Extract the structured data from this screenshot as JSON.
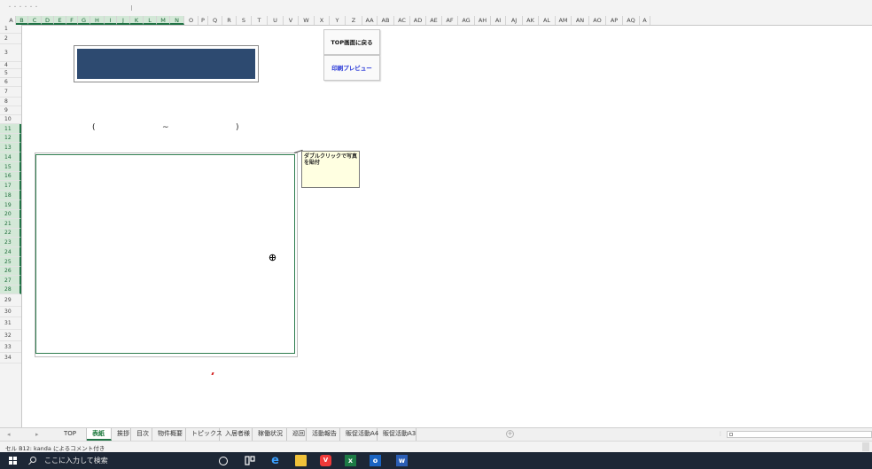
{
  "columns": [
    "A",
    "B",
    "C",
    "D",
    "E",
    "F",
    "G",
    "H",
    "I",
    "J",
    "K",
    "L",
    "M",
    "N",
    "O",
    "P",
    "Q",
    "R",
    "S",
    "T",
    "U",
    "V",
    "W",
    "X",
    "Y",
    "Z",
    "AA",
    "AB",
    "AC",
    "AD",
    "AE",
    "AF",
    "AG",
    "AH",
    "AI",
    "AJ",
    "AK",
    "AL",
    "AM",
    "AN",
    "AO",
    "AP",
    "AQ",
    "A"
  ],
  "rows": [
    "1",
    "2",
    "3",
    "4",
    "5",
    "6",
    "7",
    "8",
    "9",
    "10",
    "11",
    "12",
    "13",
    "14",
    "15",
    "16",
    "17",
    "18",
    "19",
    "20",
    "21",
    "22",
    "23",
    "24",
    "25",
    "26",
    "27",
    "28",
    "29",
    "30",
    "31",
    "32",
    "33",
    "34"
  ],
  "sheet": {
    "top_button": "TOP画面に戻る",
    "print_button": "印刷プレビュー",
    "paren_open": "(",
    "tilde": "~",
    "paren_close": ")",
    "comment_text": "ダブルクリックで写真を貼付"
  },
  "tabs": [
    "TOP",
    "表紙",
    "挨拶",
    "目次",
    "物件概要",
    "トピックス",
    "入居者様",
    "稼働状況",
    "巡回",
    "活動報告",
    "販促活動A4",
    "販促活動A3"
  ],
  "active_tab": "表紙",
  "status_text": "セル B12: kanda によるコメント付き",
  "taskbar": {
    "search_placeholder": "ここに入力して検索",
    "icons": [
      "cortana-icon",
      "task-view-icon",
      "edge-icon",
      "file-explorer-icon",
      "vivaldi-icon",
      "excel-icon",
      "outlook-icon",
      "word-icon"
    ]
  },
  "colors": {
    "title_fill": "#2d4a70",
    "selection_green": "#217346",
    "print_text": "#1f2fd6",
    "comment_bg": "#ffffe1",
    "taskbar_bg": "#1d2736"
  }
}
